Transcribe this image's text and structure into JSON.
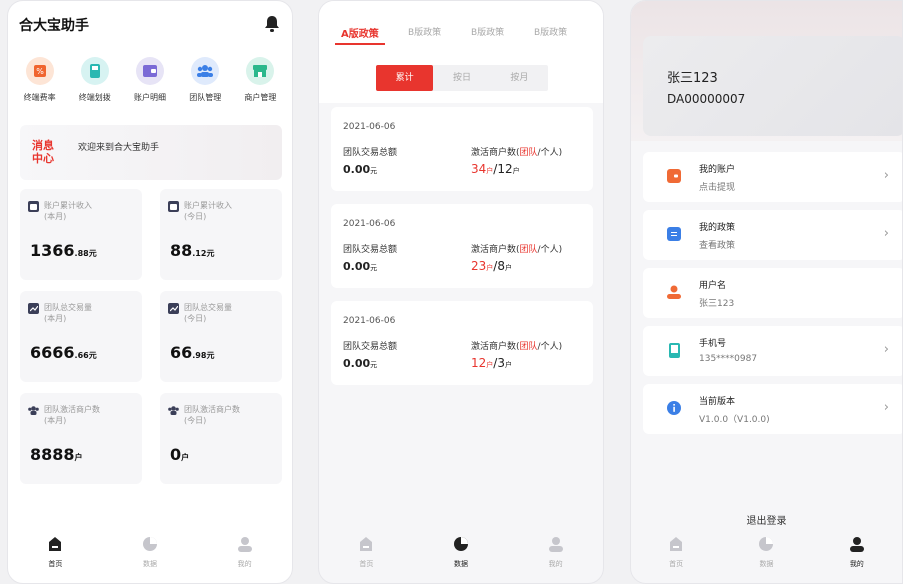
{
  "home": {
    "title": "合大宝助手",
    "quick": [
      {
        "label": "终端费率",
        "icon": "percent-icon",
        "bg": "#fde5d6",
        "fg": "#f0652f"
      },
      {
        "label": "终端划拨",
        "icon": "terminal-icon",
        "bg": "#d7f3f2",
        "fg": "#29b8b2"
      },
      {
        "label": "账户明细",
        "icon": "wallet-icon",
        "bg": "#e7e4f6",
        "fg": "#7b6ad6"
      },
      {
        "label": "团队管理",
        "icon": "team-icon",
        "bg": "#dfeafc",
        "fg": "#3b7fe6"
      },
      {
        "label": "商户管理",
        "icon": "shop-icon",
        "bg": "#d9f3eb",
        "fg": "#2bb88c"
      }
    ],
    "message": {
      "tag": "消息中心",
      "text": "欢迎来到合大宝助手"
    },
    "cards": [
      {
        "title": "账户累计收入",
        "sub": "(本月)",
        "value": "1366",
        "unit": ".88元"
      },
      {
        "title": "账户累计收入",
        "sub": "(今日)",
        "value": "88",
        "unit": ".12元"
      },
      {
        "title": "团队总交易量",
        "sub": "(本月)",
        "value": "6666",
        "unit": ".66元"
      },
      {
        "title": "团队总交易量",
        "sub": "(今日)",
        "value": "66",
        "unit": ".98元"
      },
      {
        "title": "团队激活商户数",
        "sub": "(本月)",
        "value": "8888",
        "unit": "户"
      },
      {
        "title": "团队激活商户数",
        "sub": "(今日)",
        "value": "0",
        "unit": "户"
      }
    ]
  },
  "tabbar": {
    "home": "首页",
    "data": "数据",
    "mine": "我的"
  },
  "policy": {
    "tabs": [
      "A版政策",
      "B版政策",
      "B版政策",
      "B版政策"
    ],
    "segments": [
      "累计",
      "按日",
      "按月"
    ],
    "labels": {
      "team_total": "团队交易总额",
      "active_prefix": "激活商户数(",
      "active_team": "团队",
      "active_suffix": "/个人)",
      "unit_yuan": "元",
      "unit_hu": "户"
    },
    "records": [
      {
        "date": "2021-06-06",
        "amount": "0.",
        "amount_dec": "00",
        "team": "34",
        "personal": "12"
      },
      {
        "date": "2021-06-06",
        "amount": "0.",
        "amount_dec": "00",
        "team": "23",
        "personal": "8"
      },
      {
        "date": "2021-06-06",
        "amount": "0.",
        "amount_dec": "00",
        "team": "12",
        "personal": "3"
      }
    ]
  },
  "mine": {
    "name": "张三123",
    "id": "DA00000007",
    "rows": [
      {
        "title": "我的账户",
        "sub": "点击提现",
        "icon": "wallet-icon",
        "color": "#f06a35"
      },
      {
        "title": "我的政策",
        "sub": "查看政策",
        "icon": "document-icon",
        "color": "#3b7fe6"
      },
      {
        "title": "用户名",
        "sub": "张三123",
        "icon": "user-icon",
        "color": "#f06a35"
      },
      {
        "title": "手机号",
        "sub": "135****0987",
        "icon": "phone-icon",
        "color": "#29b8b2"
      },
      {
        "title": "当前版本",
        "sub": "V1.0.0（V1.0.0)",
        "icon": "info-icon",
        "color": "#3b7fe6"
      }
    ],
    "logout": "退出登录"
  }
}
